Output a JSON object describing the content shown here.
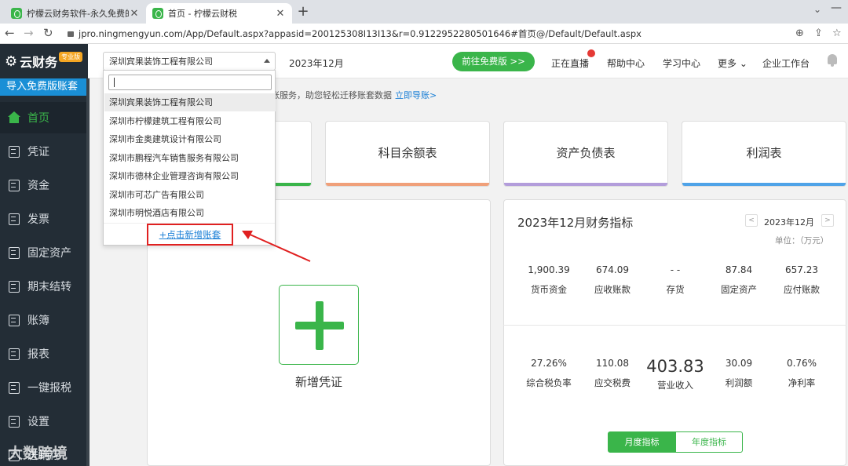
{
  "browser": {
    "tabs": [
      {
        "title": "柠檬云财务软件-永久免费的专业",
        "active": false
      },
      {
        "title": "首页 - 柠檬云财税",
        "active": true
      }
    ],
    "new_tab_icon": "plus-icon",
    "url": "jpro.ningmengyun.com/App/Default.aspx?appasid=200125308I13I13&r=0.9122952280501646#首页@/Default/Default.aspx"
  },
  "app": {
    "logo_text": "云财务",
    "logo_badge": "专业版",
    "company_selected": "深圳宾果装饰工程有限公司",
    "period": "2023年12月",
    "free_button": "前往免费版 >>",
    "nav": [
      "正在直播",
      "帮助中心",
      "学习中心",
      "更多",
      "企业工作台"
    ],
    "accent_color": "#3ab54a"
  },
  "sidebar": {
    "import_button": "导入免费版账套",
    "items": [
      {
        "label": "首页",
        "icon": "home-icon",
        "active": true
      },
      {
        "label": "凭证",
        "icon": "voucher-icon"
      },
      {
        "label": "资金",
        "icon": "money-icon"
      },
      {
        "label": "发票",
        "icon": "invoice-icon"
      },
      {
        "label": "固定资产",
        "icon": "asset-icon"
      },
      {
        "label": "期末结转",
        "icon": "calendar-icon"
      },
      {
        "label": "账簿",
        "icon": "book-icon"
      },
      {
        "label": "报表",
        "icon": "chart-icon"
      },
      {
        "label": "一键报税",
        "icon": "tax-icon"
      },
      {
        "label": "设置",
        "icon": "gear-icon"
      },
      {
        "label": "进销存",
        "icon": "inventory-icon"
      }
    ],
    "watermark": "大数跨境"
  },
  "notice": {
    "text": "账服务，助您轻松迁移账套数据",
    "link": "立即导账>"
  },
  "dropdown": {
    "items": [
      "深圳宾果装饰工程有限公司",
      "深圳市柠檬建筑工程有限公司",
      "深圳市金奥建筑设计有限公司",
      "深圳市鹏程汽车销售服务有限公司",
      "深圳市德林企业管理咨询有限公司",
      "深圳市可芯广告有限公司",
      "深圳市明悦酒店有限公司"
    ],
    "add_link": "+点击新增账套"
  },
  "cards": [
    {
      "label": "科目余额表",
      "color": "#f0a07a"
    },
    {
      "label": "资产负债表",
      "color": "#b39ddb"
    },
    {
      "label": "利润表",
      "color": "#4fa3e8"
    }
  ],
  "first_card_color": "#3ab54a",
  "new_voucher": {
    "label": "新增凭证"
  },
  "finance": {
    "title": "2023年12月财务指标",
    "period": "2023年12月",
    "unit": "单位：（万元）",
    "row1": [
      {
        "value": "1,900.39",
        "label": "货币资金"
      },
      {
        "value": "674.09",
        "label": "应收账款"
      },
      {
        "value": "- -",
        "label": "存货"
      },
      {
        "value": "87.84",
        "label": "固定资产"
      },
      {
        "value": "657.23",
        "label": "应付账款"
      }
    ],
    "row2": [
      {
        "value": "27.26%",
        "label": "综合税负率"
      },
      {
        "value": "110.08",
        "label": "应交税费"
      },
      {
        "value": "403.83",
        "label": "营业收入",
        "big": true
      },
      {
        "value": "30.09",
        "label": "利润额"
      },
      {
        "value": "0.76%",
        "label": "净利率"
      }
    ],
    "toggle": [
      "月度指标",
      "年度指标"
    ]
  }
}
